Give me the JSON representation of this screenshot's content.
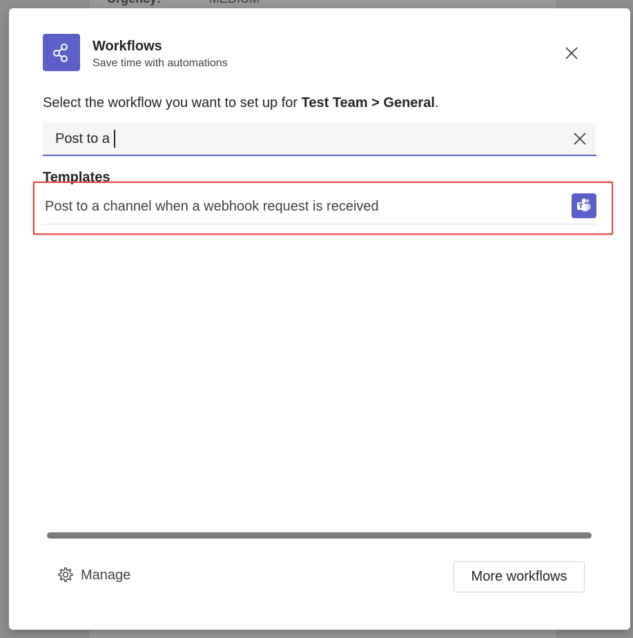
{
  "background": {
    "field_label": "Urgency:",
    "field_value": "MEDIUM"
  },
  "dialog": {
    "title": "Workflows",
    "subtitle": "Save time with automations",
    "app_icon": "share-nodes-icon",
    "close_icon": "close-icon",
    "prompt": {
      "prefix": "Select the workflow you want to set up for ",
      "team": "Test Team",
      "separator": " > ",
      "channel": "General",
      "suffix": "."
    },
    "search": {
      "value": "Post to a",
      "clear_icon": "clear-icon"
    },
    "templates": {
      "heading": "Templates",
      "items": [
        {
          "label": "Post to a channel when a webhook request is received",
          "icon": "teams-icon"
        }
      ]
    },
    "footer": {
      "manage_label": "Manage",
      "manage_icon": "gear-icon",
      "more_label": "More workflows"
    }
  },
  "colors": {
    "accent": "#5b5fc7",
    "highlight": "#e0484b"
  }
}
